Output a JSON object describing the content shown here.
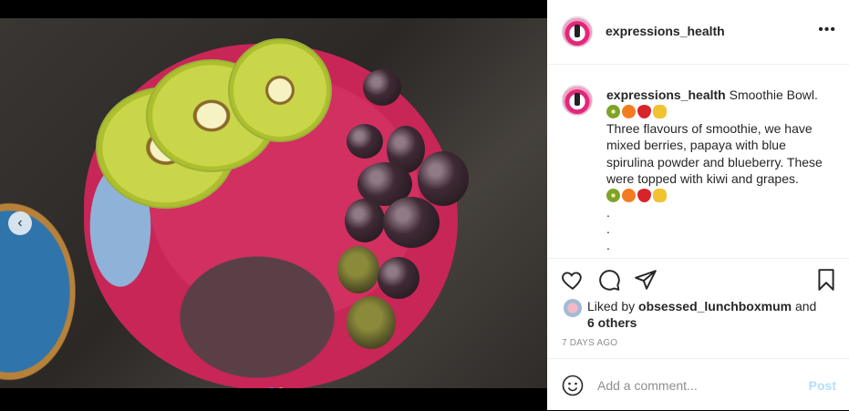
{
  "post": {
    "username": "expressions_health",
    "caption_title": "Smoothie Bowl.",
    "caption_body": "Three flavours of smoothie, we have mixed berries, papaya with blue spirulina powder and blueberry. These were topped with kiwi and grapes.",
    "emoji_row": [
      "kiwi",
      "orange",
      "strawberry",
      "pineapple"
    ],
    "dot_lines": [
      ".",
      ".",
      "."
    ],
    "liked_prefix": "Liked by ",
    "liked_user": "obsessed_lunchboxmum",
    "liked_and": " and",
    "liked_others": "6 others",
    "timestamp": "7 DAYS AGO"
  },
  "comment": {
    "placeholder": "Add a comment...",
    "post_label": "Post"
  },
  "carousel": {
    "prev_arrow": "‹",
    "dots_total": 2,
    "active_dot": 1
  },
  "header": {
    "more_label": "•••"
  },
  "colors": {
    "accent": "#3d95ef",
    "post_disabled": "#b2dffc",
    "text": "#262626",
    "muted": "#8e8e8e"
  }
}
